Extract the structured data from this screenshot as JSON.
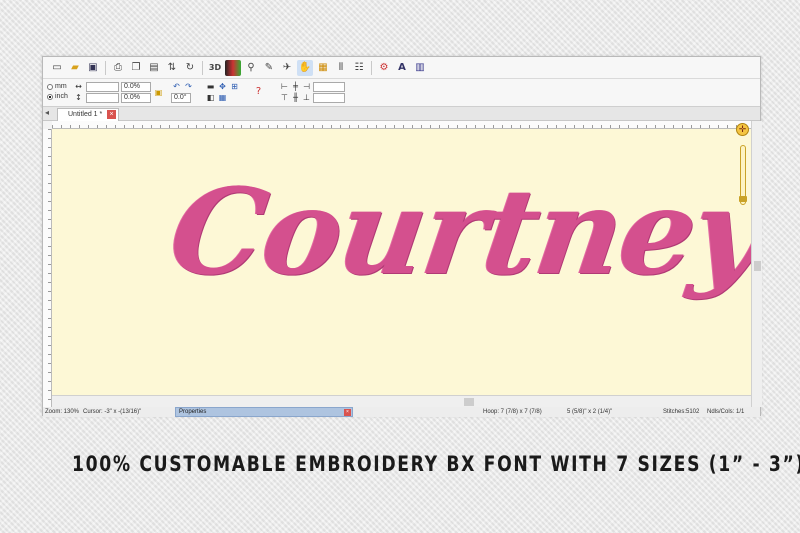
{
  "toolbar": {
    "icons": [
      "new-icon",
      "open-icon",
      "save-icon",
      "print-icon",
      "copy-icon",
      "paste-icon",
      "mirror-icon",
      "rotate-icon",
      "3d-icon",
      "color-icon",
      "zoom-icon",
      "measure-icon",
      "hoop-icon",
      "select-icon",
      "properties-icon",
      "align-icon",
      "stitch-icon",
      "settings-icon",
      "text-icon",
      "library-icon"
    ],
    "label_3d": "3D"
  },
  "toolbar2": {
    "unit_mm": "mm",
    "unit_inch": "inch",
    "width_percent": "0.0%",
    "height_percent": "0.0%",
    "rotation": "0.0°"
  },
  "tabs": [
    {
      "label": "Untitled 1 *"
    }
  ],
  "canvas": {
    "background": "#fdf8d6",
    "design_text": "Courtney",
    "thread_color": "#d4508e"
  },
  "statusbar": {
    "zoom": "Zoom: 130%",
    "cursor": "Cursor: -3\" x -(13/16)\"",
    "properties_label": "Properties",
    "hoop": "Hoop: 7 (7/8) x 7 (7/8)",
    "design_size": "5 (5/8)\" x 2 (1/4)\"",
    "stitches": "Stitches:5102",
    "ndls": "Ndls/Cols: 1/1"
  },
  "caption": "100% CUSTOMABLE EMBROIDERY BX FONT WITH 7 SIZES (1” -  3”)"
}
